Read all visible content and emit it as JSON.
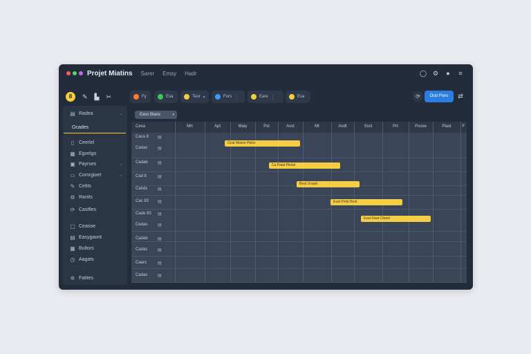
{
  "window": {
    "title": "Projet Miatins",
    "menu": [
      "Sarer",
      "Emsy",
      "Hadr"
    ],
    "title_bar_icons": [
      "search-icon",
      "settings-icon",
      "user-icon",
      "menu-icon"
    ],
    "dot_colors": [
      "#ff5f57",
      "#5ad16a",
      "#b56cf2"
    ]
  },
  "toolbar": {
    "first_badge": "8",
    "first_icons": [
      "pen-icon",
      "crop-icon",
      "scissors-icon"
    ],
    "chips": [
      {
        "label": "Fy",
        "color": "#ff7a2f",
        "arrow": ""
      },
      {
        "label": "Esa",
        "color": "#43c35b",
        "arrow": ""
      },
      {
        "label": "Teor",
        "color": "#f6cd3b",
        "arrow": "▾"
      },
      {
        "label": "Fors",
        "color": "#3b9cf2",
        "arrow": "⋮"
      },
      {
        "label": "Eare",
        "color": "#f6cd3b",
        "arrow": "⋮"
      },
      {
        "label": "Esa",
        "color": "#f6cd3b",
        "arrow": ""
      }
    ],
    "primary_button": "Orat Pons",
    "more_label": "⇄"
  },
  "sidebar": {
    "items": [
      {
        "label": "Radea",
        "icon": "document-icon",
        "icon_glyph": "▤",
        "arrow": "⌄"
      },
      {
        "label": "Ocades",
        "icon": "",
        "icon_glyph": "",
        "arrow": ""
      },
      {
        "label": "Ceerlel",
        "icon": "file-icon",
        "icon_glyph": "▯",
        "arrow": ""
      },
      {
        "label": "Egvelgo",
        "icon": "stack-icon",
        "icon_glyph": "▦",
        "arrow": ""
      },
      {
        "label": "Payrses",
        "icon": "bookmark-icon",
        "icon_glyph": "▣",
        "arrow": "⌄"
      },
      {
        "label": "Comrgioet",
        "icon": "calendar-icon",
        "icon_glyph": "▭",
        "arrow": "⌄"
      },
      {
        "label": "Cetits",
        "icon": "edit-icon",
        "icon_glyph": "✎",
        "arrow": ""
      },
      {
        "label": "Ranits",
        "icon": "tools-icon",
        "icon_glyph": "⚙",
        "arrow": ""
      },
      {
        "label": "Castfies",
        "icon": "refresh-icon",
        "icon_glyph": "⟳",
        "arrow": ""
      },
      {
        "label": "Ceasoe",
        "icon": "chat-icon",
        "icon_glyph": "▢",
        "arrow": ""
      },
      {
        "label": "Easygaont",
        "icon": "folder-icon",
        "icon_glyph": "▤",
        "arrow": ""
      },
      {
        "label": "Bultors",
        "icon": "cart-icon",
        "icon_glyph": "▦",
        "arrow": ""
      },
      {
        "label": "Aagats",
        "icon": "clock-icon",
        "icon_glyph": "◷",
        "arrow": ""
      },
      {
        "label": "Fatites",
        "icon": "gear-icon",
        "icon_glyph": "✲",
        "arrow": ""
      }
    ]
  },
  "timeline": {
    "filter_label": "Eass Blans",
    "first_column": "Cesa",
    "columns": [
      "Mrt",
      "Apt",
      "Maiy",
      "Pst",
      "Avst",
      "Mt",
      "Avdt",
      "Ssst",
      "Prt",
      "Posse",
      "Plast",
      "F"
    ],
    "rows": [
      "Caca 8",
      "Cadas",
      "Cadab",
      "Cad 8",
      "Cahds",
      "Cac 83",
      "Cade 93",
      "Cedas",
      "Cadab",
      "Cadas",
      "Caars",
      "Cadas",
      "Cadaa"
    ],
    "bars": [
      {
        "label": "Ocat Miaine Pieisr"
      },
      {
        "label": "Ca Paiat Pleisd"
      },
      {
        "label": "Beat Uraate"
      },
      {
        "label": "Esat Pelat Beat"
      },
      {
        "label": "Esat Eiast Cleast"
      }
    ]
  }
}
